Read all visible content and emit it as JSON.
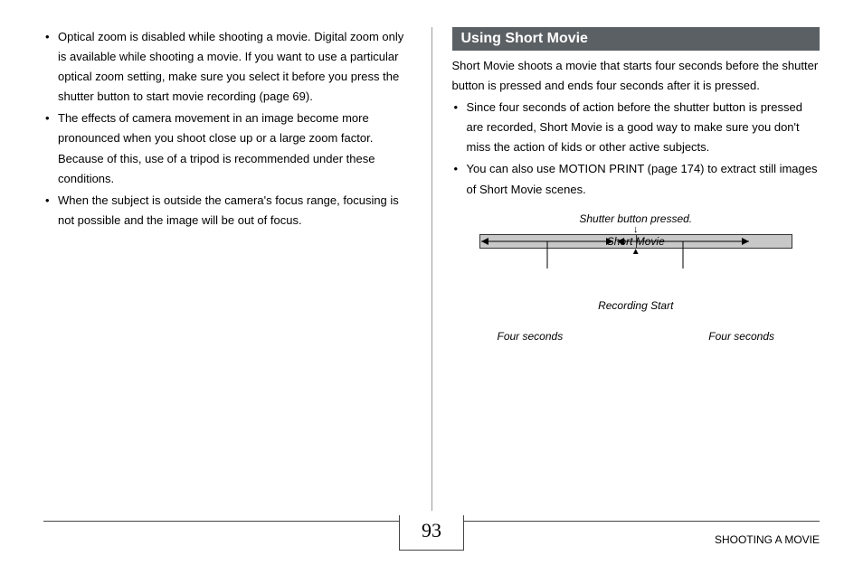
{
  "left": {
    "bullets": [
      "Optical zoom is disabled while shooting a movie. Digital zoom only is available while shooting a movie. If you want to use a particular optical zoom setting, make sure you select it before you press the shutter button to start movie recording (page 69).",
      "The effects of camera movement in an image become more pronounced when you shoot close up or a large zoom factor. Because of this, use of a tripod is recommended under these conditions.",
      "When the subject is outside the camera's focus range, focusing is not possible and the image will be out of focus."
    ]
  },
  "right": {
    "header": "Using Short Movie",
    "intro": "Short Movie shoots a movie that starts four seconds before the shutter button is pressed and ends four seconds after it is pressed.",
    "bullets": [
      "Since four seconds of action before the shutter button is pressed are recorded, Short Movie is a good way to make sure you don't miss the action of kids or other active subjects.",
      "You can also use MOTION PRINT (page 174) to extract still images of Short Movie scenes."
    ],
    "diagram": {
      "top_label": "Shutter button pressed.",
      "bar_label": "Short Movie",
      "recording_start": "Recording Start",
      "left_span": "Four seconds",
      "right_span": "Four seconds"
    }
  },
  "footer": {
    "page_number": "93",
    "chapter": "SHOOTING A MOVIE"
  }
}
